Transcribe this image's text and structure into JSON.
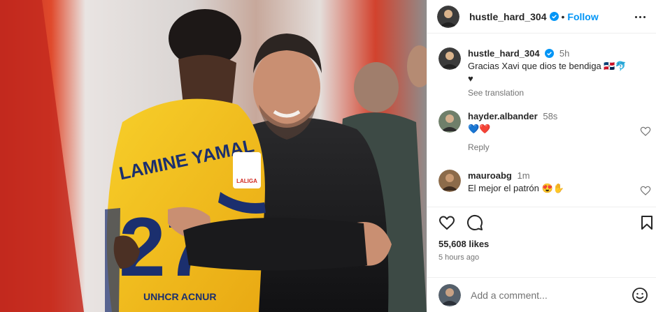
{
  "post_header": {
    "username": "hustle_hard_304",
    "dot": "•",
    "follow_label": "Follow"
  },
  "caption": {
    "username": "hustle_hard_304",
    "time": "5h",
    "text": "Gracias Xavi que dios te bendiga 🇩🇴🐬",
    "text_line2": "♥",
    "see_translation": "See translation"
  },
  "comments": [
    {
      "username": "hayder.albander",
      "time": "58s",
      "text": "💙❤️",
      "reply_label": "Reply"
    },
    {
      "username": "mauroabg",
      "time": "1m",
      "text": "El mejor el patrón 😍✋"
    }
  ],
  "actions": {
    "likes": "55,608 likes",
    "time_ago": "5 hours ago"
  },
  "add_comment": {
    "placeholder": "Add a comment..."
  },
  "photo": {
    "jersey_name": "LAMINE YAMAL",
    "jersey_number": "27",
    "sponsor": "UNHCR ACNUR",
    "sleeve_badge": "LALIGA"
  },
  "colors": {
    "accent": "#0095f6",
    "text": "#262626",
    "secondary": "#737373",
    "jersey": "#f5c518",
    "heart_red": "#ed4956"
  }
}
